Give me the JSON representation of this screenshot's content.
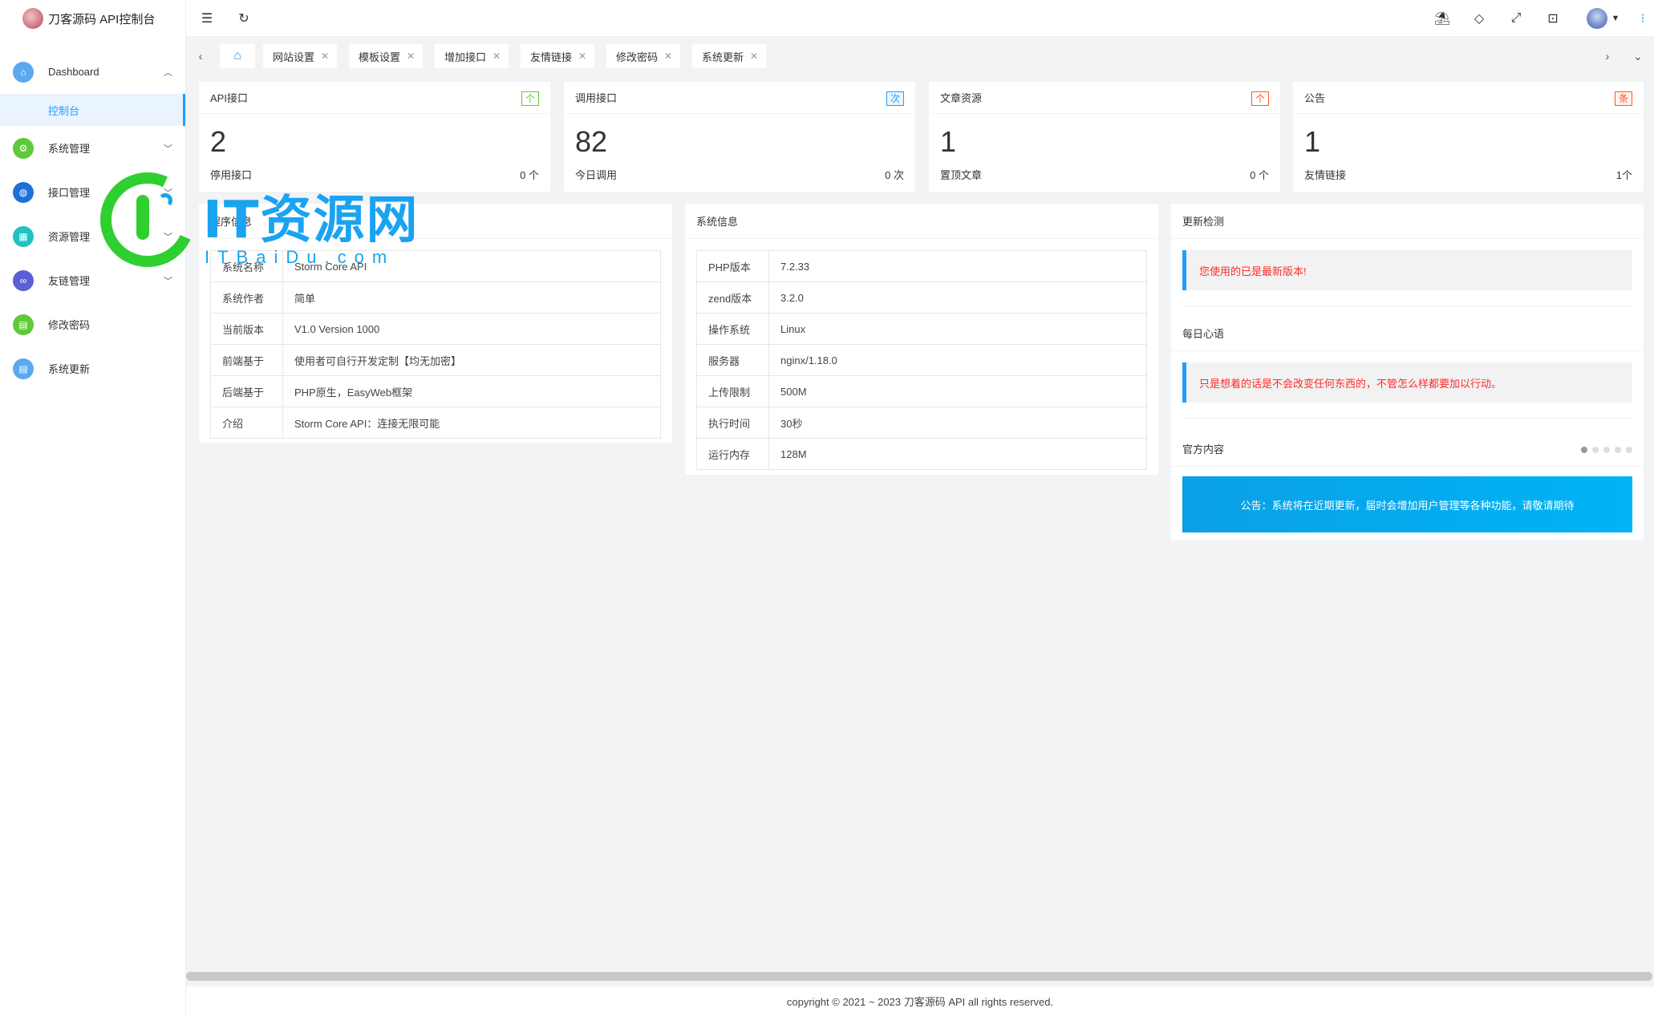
{
  "app": {
    "title": "刀客源码 API控制台"
  },
  "sidebar": {
    "items": [
      {
        "label": "Dashboard",
        "icon": "home-icon",
        "color": "#5aa8f0",
        "chevron": "up"
      },
      {
        "label": "控制台",
        "sub": true
      },
      {
        "label": "系统管理",
        "icon": "gear-icon",
        "color": "#5fc93a",
        "chevron": "down"
      },
      {
        "label": "接口管理",
        "icon": "globe-icon",
        "color": "#1e6fd9",
        "chevron": "down"
      },
      {
        "label": "资源管理",
        "icon": "grid-icon",
        "color": "#22c1c3",
        "chevron": "down"
      },
      {
        "label": "友链管理",
        "icon": "link-icon",
        "color": "#5b5fd6",
        "chevron": "down"
      },
      {
        "label": "修改密码",
        "icon": "lock-icon",
        "color": "#5fc93a"
      },
      {
        "label": "系统更新",
        "icon": "update-icon",
        "color": "#5aa8f0"
      }
    ]
  },
  "tabs": [
    {
      "label": "网站设置"
    },
    {
      "label": "模板设置"
    },
    {
      "label": "增加接口"
    },
    {
      "label": "友情链接"
    },
    {
      "label": "修改密码"
    },
    {
      "label": "系统更新"
    }
  ],
  "stats": [
    {
      "title": "API接口",
      "badge": "个",
      "badge_color": "#5fc93a",
      "value": "2",
      "foot_label": "停用接口",
      "foot_value": "0 个"
    },
    {
      "title": "调用接口",
      "badge": "次",
      "badge_color": "#1e9fff",
      "value": "82",
      "foot_label": "今日调用",
      "foot_value": "0 次"
    },
    {
      "title": "文章资源",
      "badge": "个",
      "badge_color": "#ff5722",
      "value": "1",
      "foot_label": "置顶文章",
      "foot_value": "0 个"
    },
    {
      "title": "公告",
      "badge": "条",
      "badge_color": "#ff5722",
      "value": "1",
      "foot_label": "友情链接",
      "foot_value": "1个"
    }
  ],
  "program_info": {
    "title": "程序信息",
    "rows": [
      {
        "k": "系统名称",
        "v": "Storm Core API"
      },
      {
        "k": "系统作者",
        "v": "简单"
      },
      {
        "k": "当前版本",
        "v": "V1.0 Version 1000"
      },
      {
        "k": "前端基于",
        "v": "使用者可自行开发定制【均无加密】"
      },
      {
        "k": "后端基于",
        "v": "PHP原生，EasyWeb框架"
      },
      {
        "k": "介绍",
        "v": "Storm Core API：连接无限可能"
      }
    ]
  },
  "system_info": {
    "title": "系统信息",
    "rows": [
      {
        "k": "PHP版本",
        "v": "7.2.33"
      },
      {
        "k": "zend版本",
        "v": "3.2.0"
      },
      {
        "k": "操作系统",
        "v": "Linux"
      },
      {
        "k": "服务器",
        "v": "nginx/1.18.0"
      },
      {
        "k": "上传限制",
        "v": "500M"
      },
      {
        "k": "执行时间",
        "v": "30秒"
      },
      {
        "k": "运行内存",
        "v": "128M"
      }
    ]
  },
  "update": {
    "title": "更新检测",
    "notice": "您使用的已是最新版本!",
    "daily_title": "每日心语",
    "daily_text": "只是想着的话是不会改变任何东西的，不管怎么样都要加以行动。",
    "official_title": "官方内容",
    "banner": "公告：系统将在近期更新，届时会增加用户管理等各种功能，请敬请期待"
  },
  "watermark": {
    "text": "IT资源网",
    "sub": "ITBaiDu.com"
  },
  "footer": {
    "text": "copyright © 2021 ~ 2023 刀客源码 API all rights reserved."
  }
}
